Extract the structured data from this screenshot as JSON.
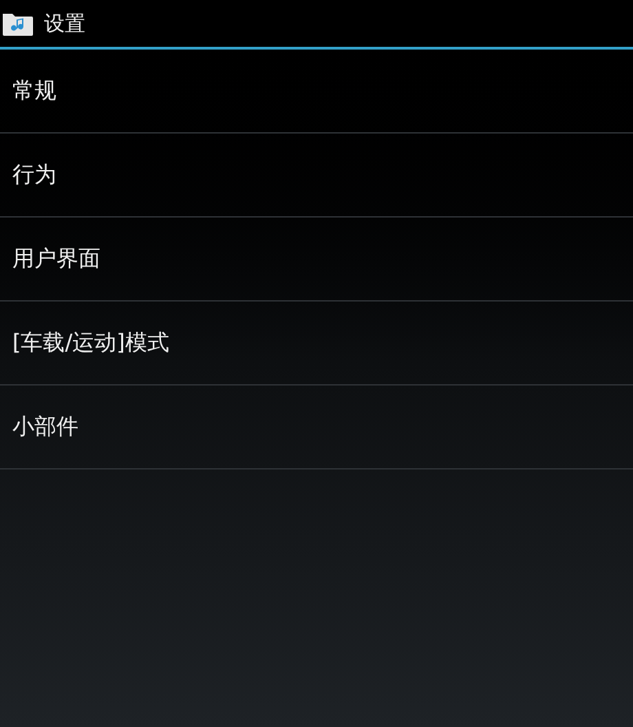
{
  "action_bar": {
    "title": "设置"
  },
  "items": [
    {
      "label": "常规"
    },
    {
      "label": "行为"
    },
    {
      "label": "用户界面"
    },
    {
      "label": "[车载/运动]模式"
    },
    {
      "label": "小部件"
    }
  ]
}
